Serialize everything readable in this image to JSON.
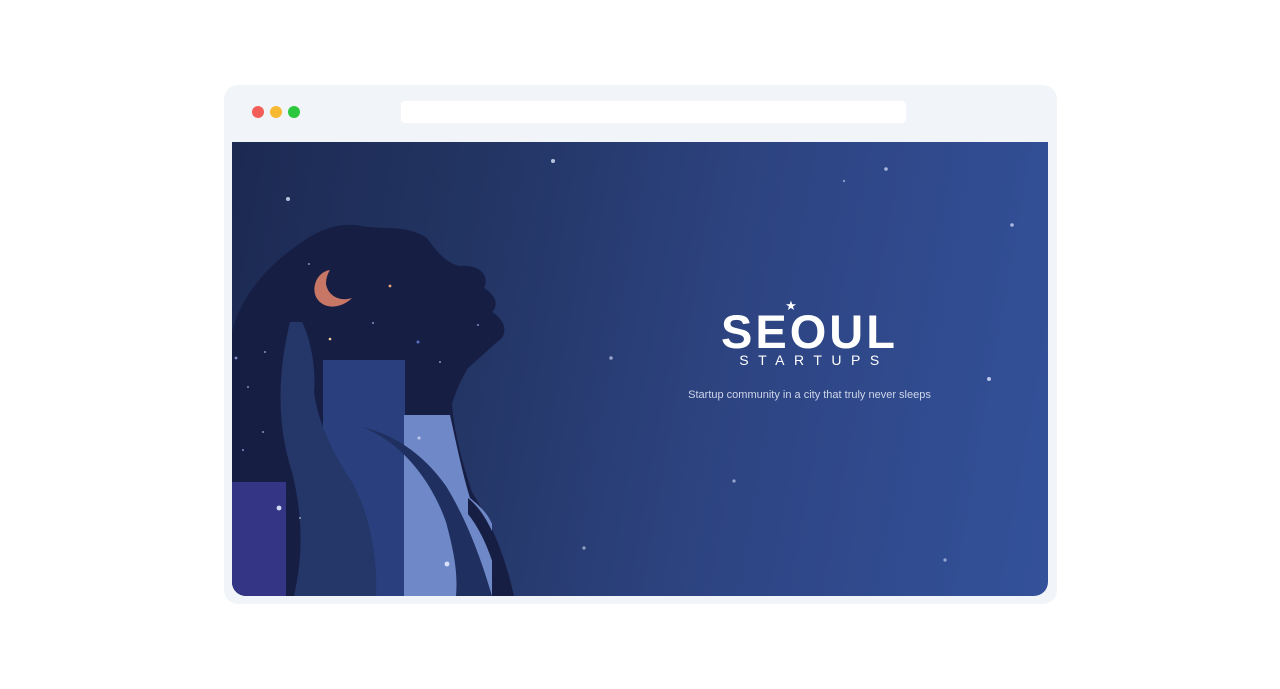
{
  "window": {
    "controls": [
      {
        "name": "close",
        "color": "#f35e58"
      },
      {
        "name": "minimize",
        "color": "#f8b932"
      },
      {
        "name": "maximize",
        "color": "#2bc83f"
      }
    ],
    "address_bar": {
      "value": ""
    }
  },
  "hero": {
    "logo": {
      "star": "★",
      "title": "SEOUL",
      "subtitle": "STARTUPS"
    },
    "tagline": "Startup community in a city that truly never sleeps",
    "colors": {
      "background_start": "#1c2a52",
      "background_end": "#33519a",
      "silhouette": "#171e44",
      "moon": "#c87766",
      "building_light": "#6f88c8",
      "building_mid": "#2a3f7d",
      "building_purple": "#343685"
    },
    "illustration": "woman-silhouette-night-city"
  }
}
